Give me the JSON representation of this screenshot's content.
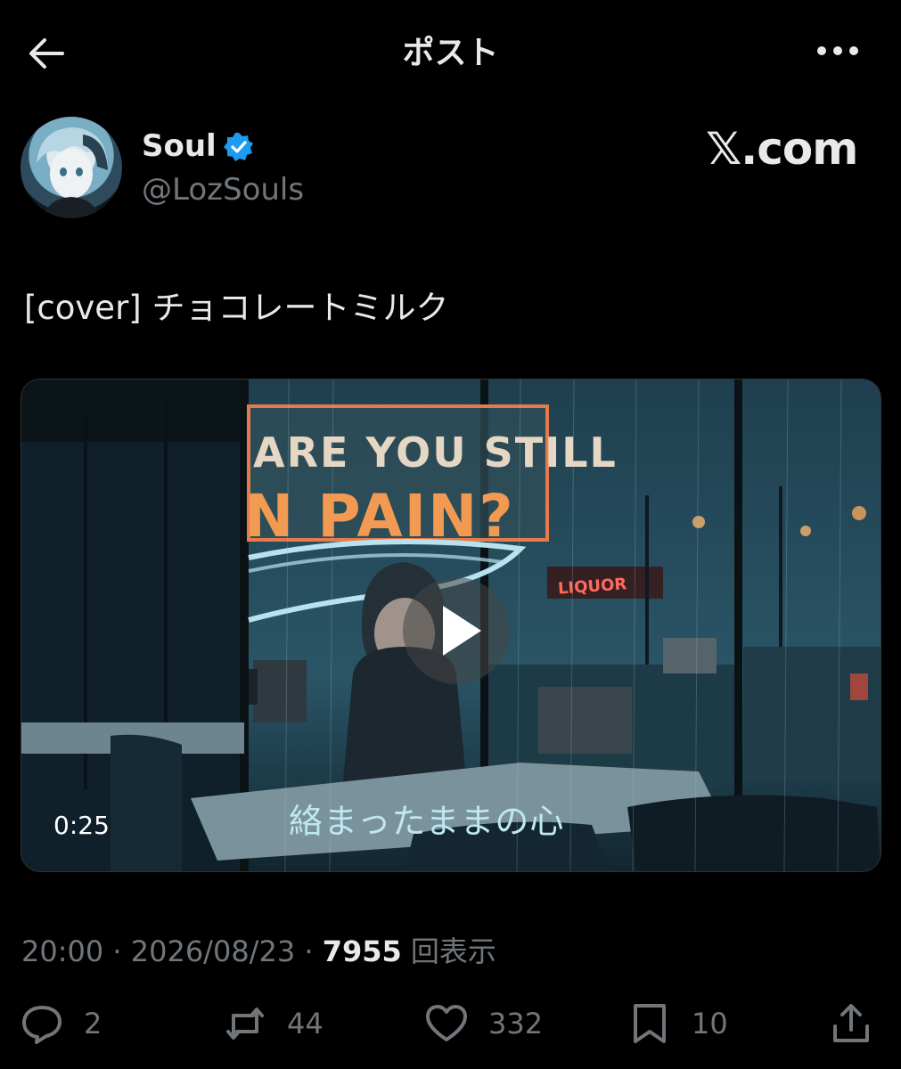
{
  "header": {
    "title": "ポスト",
    "back_icon": "arrow-left-icon",
    "more_icon": "more-horizontal-icon"
  },
  "author": {
    "display_name": "Soul",
    "handle": "@LozSouls",
    "verified": true,
    "verified_color": "#1d9bf0"
  },
  "watermark": "𝕏.com",
  "post": {
    "text": "[cover] チョコレートミルク"
  },
  "media": {
    "duration": "0:25",
    "subtitle": "絡まったままの心",
    "sign_line1": "ARE YOU STILL",
    "sign_line2": "N PAIN?",
    "shop_sign": "LIQUOR",
    "play_icon": "play-icon"
  },
  "meta": {
    "time": "20:00",
    "date": "2026/08/23",
    "views_count": "7955",
    "views_label": "回表示",
    "separator": "·"
  },
  "actions": {
    "replies": "2",
    "reposts": "44",
    "likes": "332",
    "bookmarks": "10"
  },
  "colors": {
    "background": "#000000",
    "primary_text": "#e7e9ea",
    "secondary_text": "#71767b"
  }
}
